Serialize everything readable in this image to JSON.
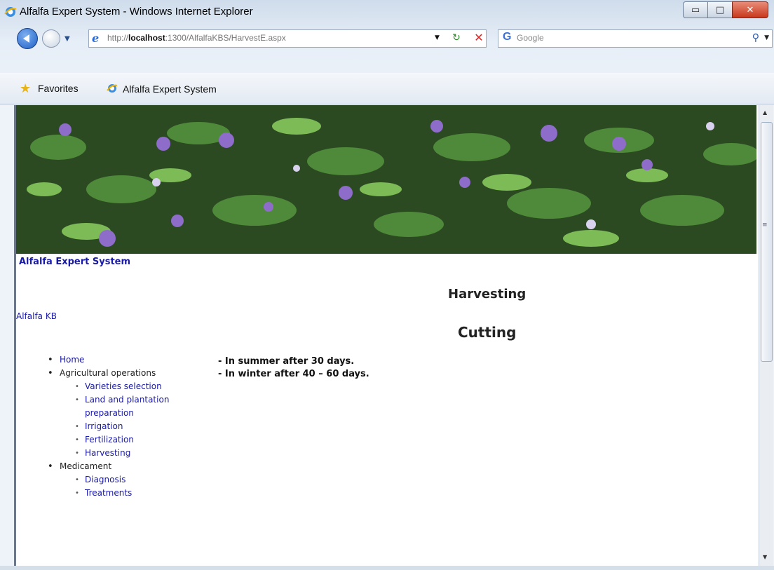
{
  "window": {
    "title": "Alfalfa Expert System - Windows Internet Explorer"
  },
  "navbar": {
    "address_prefix": "http://",
    "address_host": "localhost",
    "address_rest": ":1300/AlfalfaKBS/HarvestE.aspx",
    "search_provider": "G",
    "search_placeholder": "Google"
  },
  "favorites": {
    "label": "Favorites",
    "links": [
      {
        "label": "Alfalfa Expert System"
      }
    ]
  },
  "page": {
    "site_title": "Alfalfa Expert System",
    "kb_link": "Alfalfa KB",
    "heading": "Harvesting",
    "subheading": "Cutting",
    "info_lines": [
      "- In summer after 30 days.",
      "- In winter after 40 – 60 days."
    ]
  },
  "menu": {
    "items": [
      {
        "label": "Home",
        "link": true
      },
      {
        "label": "Agricultural operations",
        "link": false,
        "children": [
          "Varieties selection",
          "Land and plantation preparation",
          "Irrigation",
          "Fertilization",
          "Harvesting"
        ]
      },
      {
        "label": "Medicament",
        "link": false,
        "children": [
          "Diagnosis",
          "Treatments"
        ]
      }
    ]
  },
  "colors": {
    "link": "#1a1aa8",
    "banner_dark": "#1f3a18",
    "flower": "#8e6cc9"
  }
}
